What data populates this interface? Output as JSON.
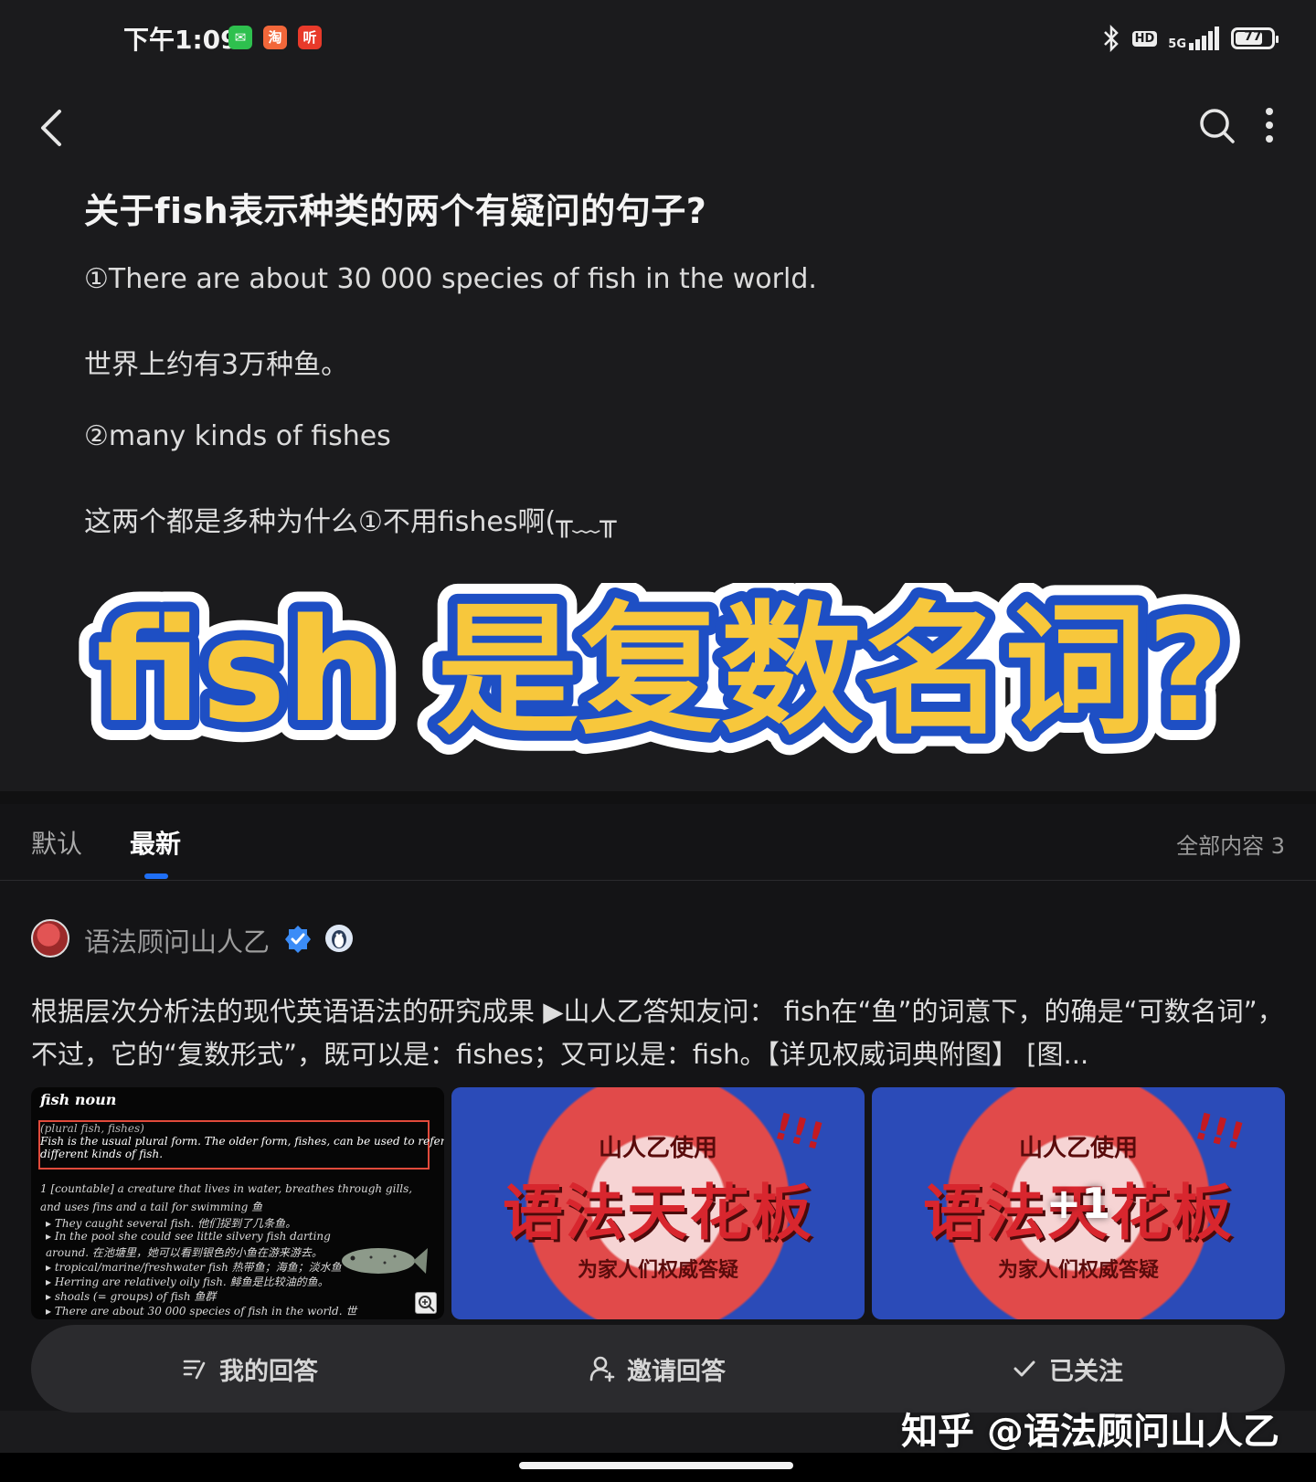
{
  "status_bar": {
    "time": "下午1:09",
    "apps": [
      {
        "name": "wechat-icon",
        "color": "#2ec04e",
        "glyph": "✉"
      },
      {
        "name": "taobao-icon",
        "color": "#f2673a",
        "glyph": "淘"
      },
      {
        "name": "listen-app-icon",
        "color": "#e83a2a",
        "glyph": "听"
      }
    ],
    "hd": "HD",
    "network": "5G",
    "battery": "77",
    "battery_level": 0.77
  },
  "nav": {
    "back": "back-icon",
    "search": "search-icon",
    "more": "more-vertical-icon"
  },
  "question": {
    "title": "关于fish表示种类的两个有疑问的句子?",
    "lines": [
      "①There are about 30 000 species of fish in the world.",
      "世界上约有3万种鱼。",
      "②many kinds of fishes",
      "这两个都是多种为什么①不用fishes啊(╥﹏╥"
    ]
  },
  "banner": {
    "text": "fish 是复数名词?",
    "fill_color": "#f7c73c",
    "outline_color": "#1e4fc4"
  },
  "tabs": {
    "items": [
      "默认",
      "最新"
    ],
    "active": "最新",
    "total": "全部内容 3",
    "accent": "#1f6ff5"
  },
  "answer": {
    "author": "语法顾问山人乙",
    "text": "根据层次分析法的现代英语语法的研究成果 ▶山人乙答知友问： fish在“鱼”的词意下，的确是“可数名词”，不过，它的“复数形式”，既可以是：fishes；又可以是：fish。【详见权威词典附图】 [图...",
    "images": {
      "dict": {
        "lines": [
          "fish  noun",
          "(plural fish, fishes)",
          "Fish is the usual plural form. The older form, fishes, can be used to refer to",
          "different kinds of fish.",
          "1  [countable] a creature that lives in water, breathes through gills,",
          "and uses fins and a tail for swimming 鱼",
          "▸ They caught several fish. 他们捉到了几条鱼。",
          "▸ In the pool she could see little silvery fish darting",
          "around. 在池塘里，她可以看到银色的小鱼在游来游去。",
          "▸ tropical/marine/freshwater fish 热带鱼；海鱼；淡水鱼",
          "▸ Herring are relatively oily fish. 鲱鱼是比较油的鱼。",
          "▸ shoals (= groups) of fish 鱼群",
          "▸ There are about 30 000 species of fish in the world. 世"
        ]
      },
      "poster": {
        "top": "山人乙使用",
        "main": "语法天花板",
        "sub": "为家人们权威答疑",
        "exclaim": "!!!"
      },
      "more_count": "+1"
    }
  },
  "actions": {
    "my_answer": "我的回答",
    "invite": "邀请回答",
    "followed": "已关注"
  },
  "watermark": "知乎 @语法顾问山人乙"
}
